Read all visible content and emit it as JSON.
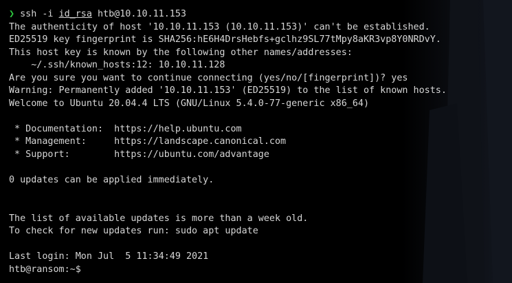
{
  "command": {
    "arrow": "❯",
    "prefix": " ssh -i ",
    "keyfile": "id_rsa",
    "target": " htb@10.10.11.153"
  },
  "output_lines": [
    "The authenticity of host '10.10.11.153 (10.10.11.153)' can't be established.",
    "ED25519 key fingerprint is SHA256:hE6H4DrsHebfs+gclhz9SL77tMpy8aKR3vp8Y0NRDvY.",
    "This host key is known by the following other names/addresses:",
    "    ~/.ssh/known_hosts:12: 10.10.11.128",
    "Are you sure you want to continue connecting (yes/no/[fingerprint])? yes",
    "Warning: Permanently added '10.10.11.153' (ED25519) to the list of known hosts.",
    "Welcome to Ubuntu 20.04.4 LTS (GNU/Linux 5.4.0-77-generic x86_64)",
    "",
    " * Documentation:  https://help.ubuntu.com",
    " * Management:     https://landscape.canonical.com",
    " * Support:        https://ubuntu.com/advantage",
    "",
    "0 updates can be applied immediately.",
    "",
    "",
    "The list of available updates is more than a week old.",
    "To check for new updates run: sudo apt update",
    "",
    "Last login: Mon Jul  5 11:34:49 2021"
  ],
  "shell_prompt": "htb@ransom:~$",
  "colors": {
    "background": "#000000",
    "text": "#d6d6d6",
    "prompt_arrow": "#2ecc40"
  }
}
